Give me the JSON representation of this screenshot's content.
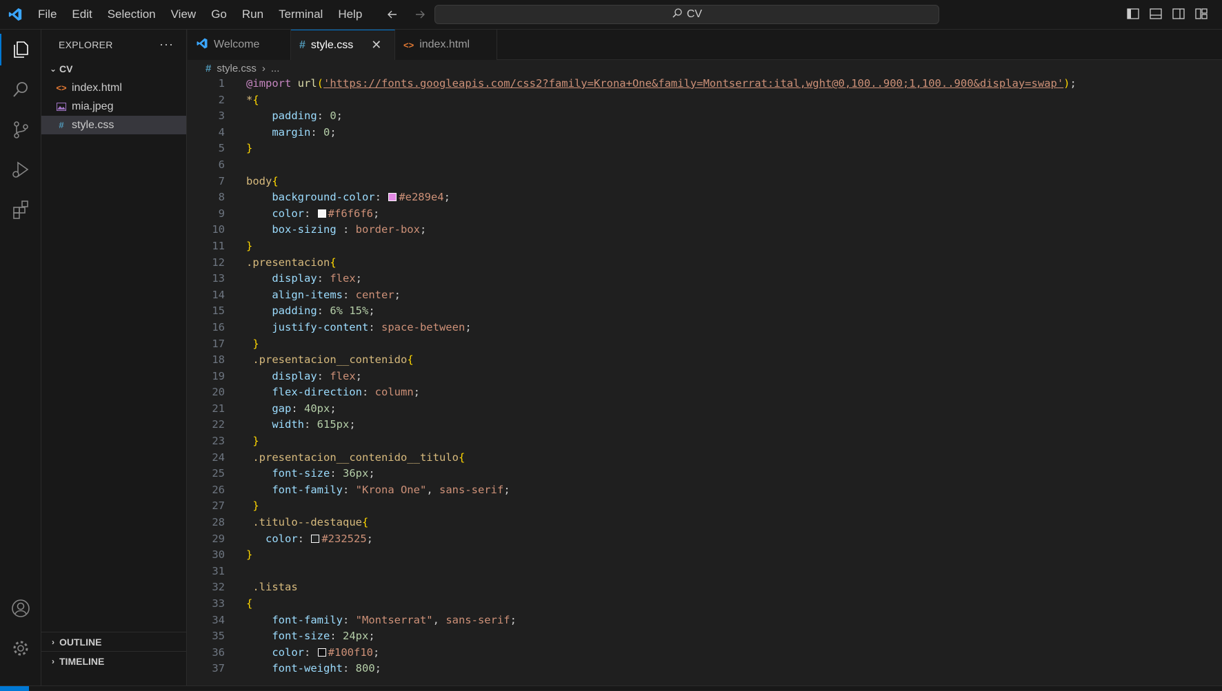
{
  "menu": [
    "File",
    "Edit",
    "Selection",
    "View",
    "Go",
    "Run",
    "Terminal",
    "Help"
  ],
  "command_center": {
    "text": "CV",
    "icon": "search-icon"
  },
  "sidebar": {
    "title": "EXPLORER",
    "folder": "CV",
    "files": [
      {
        "name": "index.html",
        "icon": "html-file-icon"
      },
      {
        "name": "mia.jpeg",
        "icon": "image-file-icon"
      },
      {
        "name": "style.css",
        "icon": "css-file-icon",
        "selected": true
      }
    ],
    "outline": "OUTLINE",
    "timeline": "TIMELINE"
  },
  "tabs": [
    {
      "label": "Welcome",
      "icon": "vscode-icon"
    },
    {
      "label": "style.css",
      "icon": "css-file-icon",
      "active": true
    },
    {
      "label": "index.html",
      "icon": "html-file-icon"
    }
  ],
  "breadcrumb": {
    "file": "style.css",
    "rest": "..."
  },
  "code_lines": [
    "@import url('https://fonts.googleapis.com/css2?family=Krona+One&family=Montserrat:ital,wght@0,100..900;1,100..900&display=swap');",
    "*{",
    "    padding: 0;",
    "    margin: 0;",
    "}",
    "",
    "body{",
    "    background-color: #e289e4;",
    "    color: #f6f6f6;",
    "    box-sizing : border-box;",
    "}",
    ".presentacion{",
    "    display: flex;",
    "    align-items: center;",
    "    padding: 6% 15%;",
    "    justify-content: space-between;",
    " }",
    " .presentacion__contenido{",
    "    display: flex;",
    "    flex-direction: column;",
    "    gap: 40px;",
    "    width: 615px;",
    " }",
    " .presentacion__contenido__titulo{",
    "    font-size: 36px;",
    "    font-family: \"Krona One\", sans-serif;",
    " }",
    " .titulo--destaque{",
    "   color: #232525;",
    "}",
    "",
    " .listas",
    "{",
    "    font-family: \"Montserrat\", sans-serif;",
    "    font-size: 24px;",
    "    color: #100f10;",
    "    font-weight: 800;"
  ],
  "swatches": {
    "8": "#e289e4",
    "9": "#f6f6f6",
    "29": "#232525",
    "36": "#100f10"
  }
}
